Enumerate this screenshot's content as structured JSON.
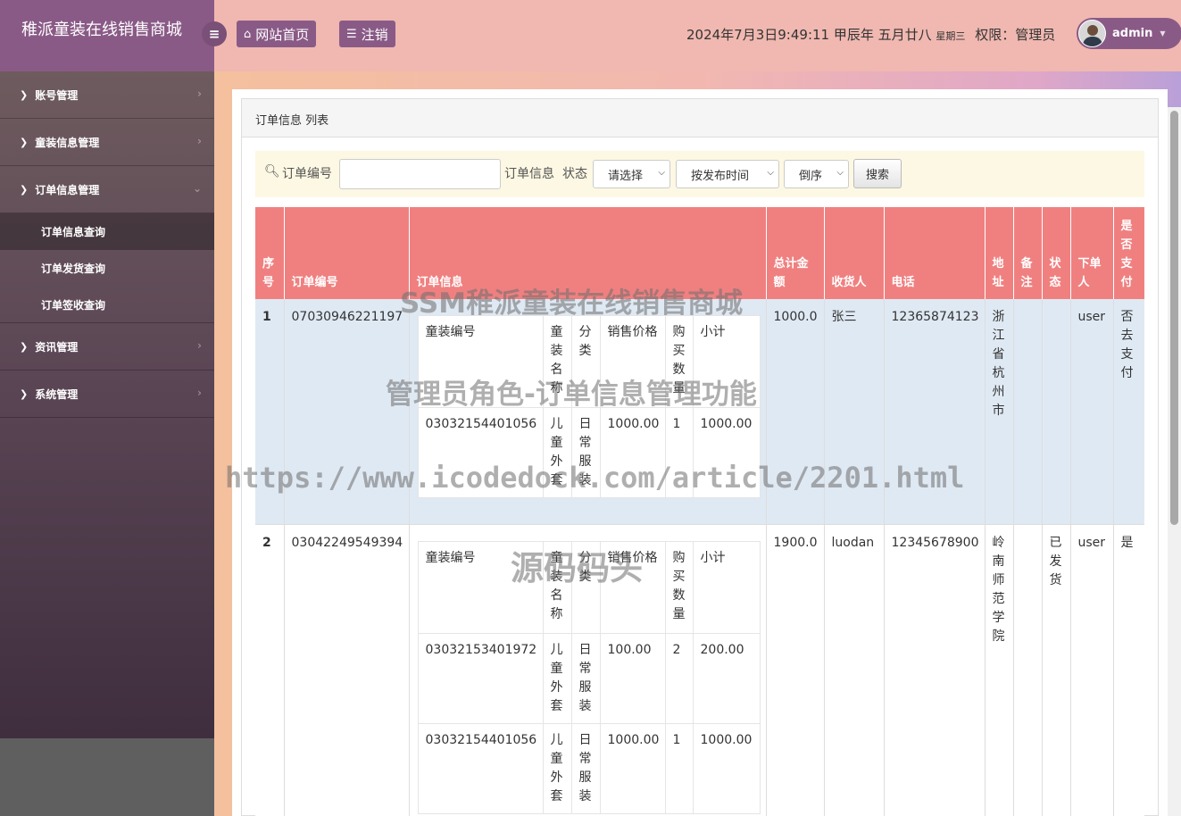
{
  "brand": {
    "title": "稚派童装在线销售商城"
  },
  "sidebar": {
    "items": [
      {
        "label": "账号管理",
        "expanded": false
      },
      {
        "label": "童装信息管理",
        "expanded": false
      },
      {
        "label": "订单信息管理",
        "expanded": true,
        "children": [
          {
            "label": "订单信息查询",
            "active": true
          },
          {
            "label": "订单发货查询",
            "active": false
          },
          {
            "label": "订单签收查询",
            "active": false
          }
        ]
      },
      {
        "label": "资讯管理",
        "expanded": false
      },
      {
        "label": "系统管理",
        "expanded": false
      }
    ]
  },
  "topbar": {
    "home_label": "网站首页",
    "logout_label": "注销",
    "datetime": "2024年7月3日9:49:11 甲辰年 五月廿八",
    "weekday": "星期三",
    "permission": "权限：管理员",
    "username": "admin"
  },
  "panel": {
    "title": "订单信息 列表"
  },
  "search": {
    "order_no_label": "订单编号",
    "order_info_label": "订单信息",
    "status_label": "状态",
    "status_select": "请选择",
    "sort_select": "按发布时间",
    "order_select": "倒序",
    "button": "搜索",
    "order_no_value": ""
  },
  "table": {
    "headers": [
      "序号",
      "订单编号",
      "订单信息",
      "总计金额",
      "收货人",
      "电话",
      "地址",
      "备注",
      "状态",
      "下单人",
      "是否支付"
    ],
    "inner_headers": [
      "童装编号",
      "童装名称",
      "分类",
      "销售价格",
      "购买数量",
      "小计"
    ],
    "rows": [
      {
        "seq": "1",
        "order_no": "07030946221197",
        "items": [
          {
            "code": "03032154401056",
            "name": "儿童外套",
            "category": "日常服装",
            "price": "1000.00",
            "qty": "1",
            "subtotal": "1000.00"
          }
        ],
        "total": "1000.0",
        "receiver": "张三",
        "phone": "12365874123",
        "address": "浙江省杭州市",
        "remark": "",
        "status": "",
        "orderer": "user",
        "paid": "否去支付"
      },
      {
        "seq": "2",
        "order_no": "03042249549394",
        "items": [
          {
            "code": "03032153401972",
            "name": "儿童外套",
            "category": "日常服装",
            "price": "100.00",
            "qty": "2",
            "subtotal": "200.00"
          },
          {
            "code": "03032154401056",
            "name": "儿童外套",
            "category": "日常服装",
            "price": "1000.00",
            "qty": "1",
            "subtotal": "1000.00"
          }
        ],
        "total": "1900.0",
        "receiver": "luodan",
        "phone": "12345678900",
        "address": "岭南师范学院",
        "remark": "",
        "status": "已发货",
        "orderer": "user",
        "paid": "是"
      }
    ]
  },
  "watermark": {
    "line1": "SSM稚派童装在线销售商城",
    "line2": "管理员角色-订单信息管理功能",
    "line3": "https://www.icodedock.com/article/2201.html",
    "line4": "源码码头"
  },
  "colors": {
    "brand_bg": "#8a5a87",
    "topbar_bg": "#f0b8b0",
    "table_header": "#f08080",
    "row_highlight": "#dfe9f3",
    "search_bar_bg": "#fcf8e3"
  }
}
